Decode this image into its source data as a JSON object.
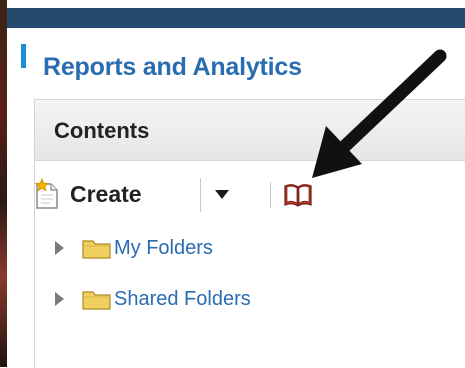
{
  "app": {
    "title": "Reports and Analytics"
  },
  "panel": {
    "title": "Contents"
  },
  "toolbar": {
    "create_label": "Create",
    "create_icon": "create-new-icon",
    "dropdown_icon": "caret-down-icon",
    "catalog_icon": "open-book-icon"
  },
  "tree": {
    "items": [
      {
        "label": "My Folders",
        "icon": "folder-icon",
        "expander": "triangle-right"
      },
      {
        "label": "Shared Folders",
        "icon": "folder-icon",
        "expander": "triangle-right"
      }
    ]
  },
  "annotation": {
    "type": "arrow",
    "color": "#111111",
    "points_to": "catalog-button"
  },
  "colors": {
    "top_bar": "#244a6e",
    "title_text": "#2a6cb0",
    "title_marker": "#1c8fd6",
    "link_text": "#2a6cb0",
    "folder": "#f0d060"
  }
}
